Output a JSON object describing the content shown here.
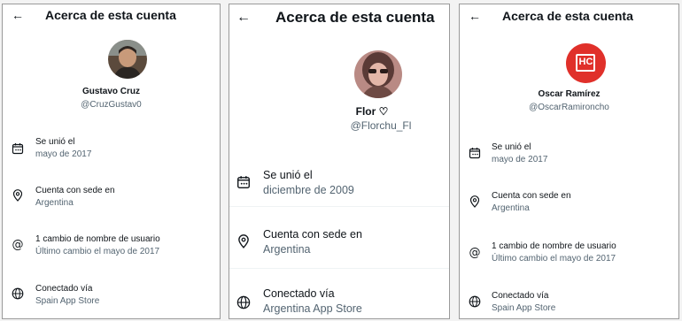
{
  "panels": [
    {
      "title": "Acerca de esta cuenta",
      "name": "Gustavo Cruz",
      "handle": "@CruzGustav0",
      "joined_label": "Se unió el",
      "joined_value": "mayo de 2017",
      "location_label": "Cuenta con sede en",
      "location_value": "Argentina",
      "username_changes_label": "1 cambio de nombre de usuario",
      "username_changes_value": "Último cambio el mayo de 2017",
      "connected_label": "Conectado vía",
      "connected_value": "Spain App Store"
    },
    {
      "title": "Acerca de esta cuenta",
      "name": "Flor ♡",
      "handle": "@Florchu_Fl",
      "joined_label": "Se unió el",
      "joined_value": "diciembre de 2009",
      "location_label": "Cuenta con sede en",
      "location_value": "Argentina",
      "connected_label": "Conectado vía",
      "connected_value": "Argentina App Store"
    },
    {
      "title": "Acerca de esta cuenta",
      "name": "Oscar Ramírez",
      "handle": "@OscarRamironcho",
      "avatar_text": "HC",
      "joined_label": "Se unió el",
      "joined_value": "mayo de 2017",
      "location_label": "Cuenta con sede en",
      "location_value": "Argentina",
      "username_changes_label": "1 cambio de nombre de usuario",
      "username_changes_value": "Último cambio el mayo de 2017",
      "connected_label": "Conectado vía",
      "connected_value": "Spain App Store"
    }
  ],
  "colors": {
    "text_primary": "#0f1419",
    "text_secondary": "#536471",
    "avatar_red": "#e0302a"
  },
  "icons": {
    "back": "arrow-left-icon",
    "joined": "calendar-icon",
    "location": "location-pin-icon",
    "username_changes": "at-sign-icon",
    "connected": "globe-icon"
  }
}
